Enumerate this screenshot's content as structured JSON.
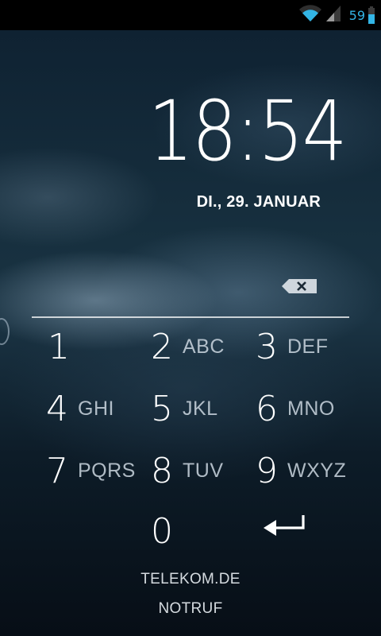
{
  "status_bar": {
    "battery_percent": "59",
    "battery_level": 0.59,
    "wifi_icon": "wifi-icon",
    "signal_icon": "signal-icon",
    "accent_color": "#33b5e5"
  },
  "lockscreen": {
    "time": "18:54",
    "date": "DI., 29. JANUAR"
  },
  "keypad": {
    "keys": [
      {
        "num": "1",
        "letters": ""
      },
      {
        "num": "2",
        "letters": "ABC"
      },
      {
        "num": "3",
        "letters": "DEF"
      },
      {
        "num": "4",
        "letters": "GHI"
      },
      {
        "num": "5",
        "letters": "JKL"
      },
      {
        "num": "6",
        "letters": "MNO"
      },
      {
        "num": "7",
        "letters": "PQRS"
      },
      {
        "num": "8",
        "letters": "TUV"
      },
      {
        "num": "9",
        "letters": "WXYZ"
      },
      {
        "num": "0",
        "letters": ""
      }
    ],
    "backspace_icon": "backspace-icon",
    "enter_icon": "enter-arrow-icon"
  },
  "footer": {
    "carrier": "TELEKOM.DE",
    "emergency": "NOTRUF"
  }
}
